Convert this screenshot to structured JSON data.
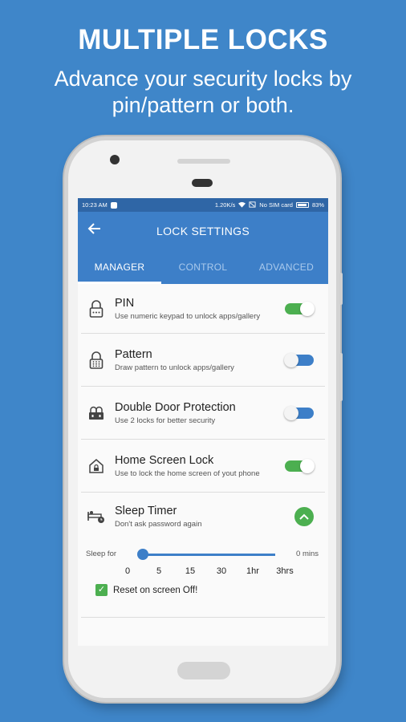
{
  "promo": {
    "title": "MULTIPLE LOCKS",
    "subtitle": "Advance your security locks by pin/pattern or both."
  },
  "status_bar": {
    "time": "10:23 AM",
    "speed": "1.20K/s",
    "sim": "No SIM card",
    "battery": "83%"
  },
  "app_bar": {
    "title": "LOCK SETTINGS"
  },
  "tabs": [
    {
      "label": "MANAGER",
      "active": true
    },
    {
      "label": "CONTROL",
      "active": false
    },
    {
      "label": "ADVANCED",
      "active": false
    }
  ],
  "settings": [
    {
      "title": "PIN",
      "desc": "Use numeric keypad to unlock apps/gallery",
      "icon": "lock-pin-icon",
      "enabled": true
    },
    {
      "title": "Pattern",
      "desc": "Draw pattern to unlock apps/gallery",
      "icon": "lock-pattern-icon",
      "enabled": false
    },
    {
      "title": "Double Door Protection",
      "desc": "Use 2 locks for better security",
      "icon": "double-lock-icon",
      "enabled": false
    },
    {
      "title": "Home Screen Lock",
      "desc": "Use to lock the home screen of yout phone",
      "icon": "home-lock-icon",
      "enabled": true
    }
  ],
  "sleep_timer": {
    "title": "Sleep Timer",
    "desc": "Don't ask password again",
    "slider_label": "Sleep for",
    "value_text": "0 mins",
    "ticks": [
      "0",
      "5",
      "15",
      "30",
      "1hr",
      "3hrs"
    ],
    "reset_label": "Reset on screen Off!",
    "reset_checked": true
  },
  "colors": {
    "background": "#3f86c9",
    "primary": "#3d7fc8",
    "accent_on": "#4caf50"
  }
}
